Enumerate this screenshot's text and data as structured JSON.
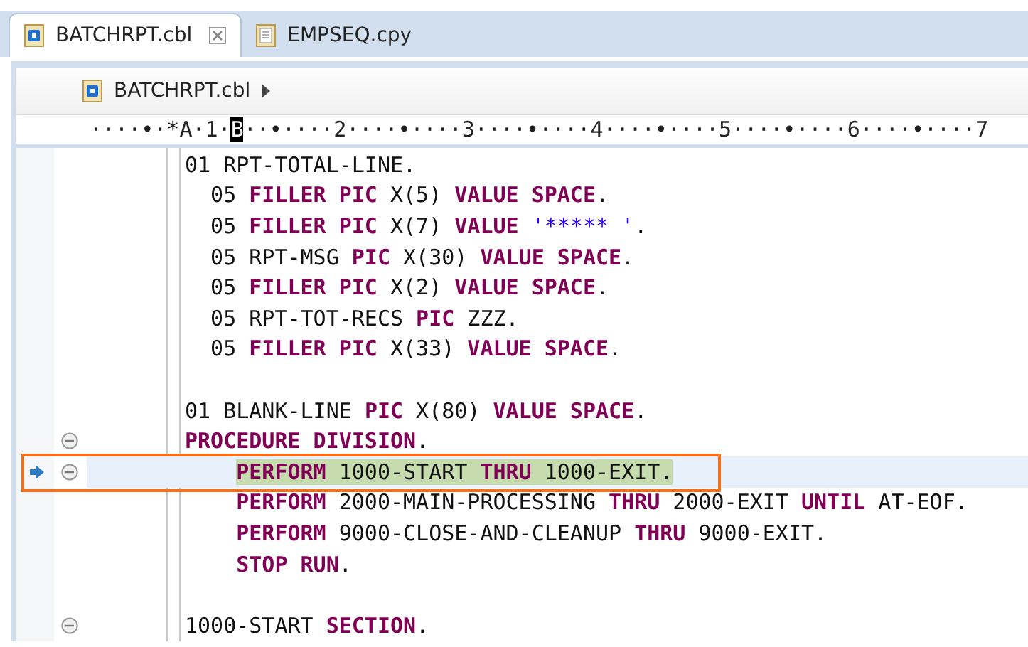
{
  "tabs": [
    {
      "label": "BATCHRPT.cbl",
      "selected": true
    },
    {
      "label": "EMPSEQ.cpy",
      "selected": false
    }
  ],
  "breadcrumb": {
    "label": "BATCHRPT.cbl"
  },
  "ruler": {
    "before": "····•·*A·1·",
    "cursor": "B",
    "after": "··•····2····•····3····•····4····•····5····•····6····•····7"
  },
  "lines": [
    {
      "kind": "header",
      "fold": false,
      "current": false,
      "annotated": false,
      "tokens": [
        {
          "text": "01 RPT-TOTAL-LINE.",
          "kind": "plain"
        }
      ]
    },
    {
      "kind": "field",
      "fold": false,
      "current": false,
      "annotated": false,
      "tokens": [
        {
          "text": "05 ",
          "kind": "plain"
        },
        {
          "text": "FILLER PIC",
          "kind": "keyword"
        },
        {
          "text": " X(5) ",
          "kind": "plain"
        },
        {
          "text": "VALUE SPACE",
          "kind": "keyword"
        },
        {
          "text": ".",
          "kind": "plain"
        }
      ]
    },
    {
      "kind": "field",
      "fold": false,
      "current": false,
      "annotated": false,
      "tokens": [
        {
          "text": "05 ",
          "kind": "plain"
        },
        {
          "text": "FILLER PIC",
          "kind": "keyword"
        },
        {
          "text": " X(7) ",
          "kind": "plain"
        },
        {
          "text": "VALUE ",
          "kind": "keyword"
        },
        {
          "text": "'***** '",
          "kind": "string"
        },
        {
          "text": ".",
          "kind": "plain"
        }
      ]
    },
    {
      "kind": "field",
      "fold": false,
      "current": false,
      "annotated": false,
      "tokens": [
        {
          "text": "05 RPT-MSG ",
          "kind": "plain"
        },
        {
          "text": "PIC",
          "kind": "keyword"
        },
        {
          "text": " X(30) ",
          "kind": "plain"
        },
        {
          "text": "VALUE SPACE",
          "kind": "keyword"
        },
        {
          "text": ".",
          "kind": "plain"
        }
      ]
    },
    {
      "kind": "field",
      "fold": false,
      "current": false,
      "annotated": false,
      "tokens": [
        {
          "text": "05 ",
          "kind": "plain"
        },
        {
          "text": "FILLER PIC",
          "kind": "keyword"
        },
        {
          "text": " X(2) ",
          "kind": "plain"
        },
        {
          "text": "VALUE SPACE",
          "kind": "keyword"
        },
        {
          "text": ".",
          "kind": "plain"
        }
      ]
    },
    {
      "kind": "field",
      "fold": false,
      "current": false,
      "annotated": false,
      "tokens": [
        {
          "text": "05 RPT-TOT-RECS ",
          "kind": "plain"
        },
        {
          "text": "PIC",
          "kind": "keyword"
        },
        {
          "text": " ZZZ.",
          "kind": "plain"
        }
      ]
    },
    {
      "kind": "field",
      "fold": false,
      "current": false,
      "annotated": false,
      "tokens": [
        {
          "text": "05 ",
          "kind": "plain"
        },
        {
          "text": "FILLER PIC",
          "kind": "keyword"
        },
        {
          "text": " X(33) ",
          "kind": "plain"
        },
        {
          "text": "VALUE SPACE",
          "kind": "keyword"
        },
        {
          "text": ".",
          "kind": "plain"
        }
      ]
    },
    {
      "kind": "blank",
      "fold": false,
      "current": false,
      "annotated": false
    },
    {
      "kind": "header",
      "fold": false,
      "current": false,
      "annotated": false,
      "tokens": [
        {
          "text": "01 BLANK-LINE ",
          "kind": "plain"
        },
        {
          "text": "PIC",
          "kind": "keyword"
        },
        {
          "text": " X(80) ",
          "kind": "plain"
        },
        {
          "text": "VALUE SPACE",
          "kind": "keyword"
        },
        {
          "text": ".",
          "kind": "plain"
        }
      ]
    },
    {
      "kind": "header",
      "fold": true,
      "current": false,
      "annotated": false,
      "tokens": [
        {
          "text": "PROCEDURE DIVISION",
          "kind": "keyword"
        },
        {
          "text": ".",
          "kind": "plain"
        }
      ]
    },
    {
      "kind": "statement",
      "fold": true,
      "current": true,
      "annotated": true,
      "tokens": [
        {
          "text": "PERFORM",
          "kind": "keyword"
        },
        {
          "text": " 1000-START ",
          "kind": "plain"
        },
        {
          "text": "THRU",
          "kind": "keyword"
        },
        {
          "text": " 1000-EXIT.",
          "kind": "plain"
        }
      ]
    },
    {
      "kind": "statement",
      "fold": false,
      "current": false,
      "annotated": false,
      "tokens": [
        {
          "text": "PERFORM",
          "kind": "keyword"
        },
        {
          "text": " 2000-MAIN-PROCESSING ",
          "kind": "plain"
        },
        {
          "text": "THRU",
          "kind": "keyword"
        },
        {
          "text": " 2000-EXIT ",
          "kind": "plain"
        },
        {
          "text": "UNTIL",
          "kind": "keyword"
        },
        {
          "text": " AT-EOF.",
          "kind": "plain"
        }
      ]
    },
    {
      "kind": "statement",
      "fold": false,
      "current": false,
      "annotated": false,
      "tokens": [
        {
          "text": "PERFORM",
          "kind": "keyword"
        },
        {
          "text": " 9000-CLOSE-AND-CLEANUP ",
          "kind": "plain"
        },
        {
          "text": "THRU",
          "kind": "keyword"
        },
        {
          "text": " 9000-EXIT.",
          "kind": "plain"
        }
      ]
    },
    {
      "kind": "statement",
      "fold": false,
      "current": false,
      "annotated": false,
      "tokens": [
        {
          "text": "STOP RUN",
          "kind": "keyword"
        },
        {
          "text": ".",
          "kind": "plain"
        }
      ]
    },
    {
      "kind": "blank",
      "fold": false,
      "current": false,
      "annotated": false
    },
    {
      "kind": "header",
      "fold": true,
      "current": false,
      "annotated": false,
      "tokens": [
        {
          "text": "1000-START ",
          "kind": "plain"
        },
        {
          "text": "SECTION",
          "kind": "keyword"
        },
        {
          "text": ".",
          "kind": "plain"
        }
      ]
    }
  ]
}
